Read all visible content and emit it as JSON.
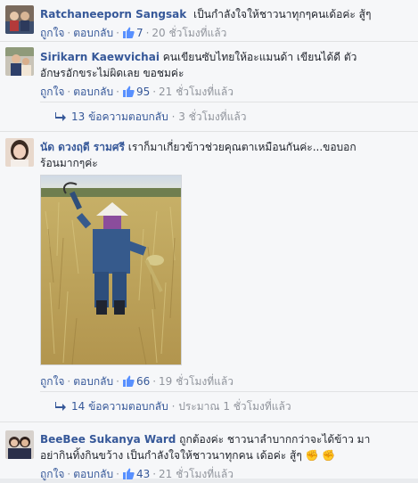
{
  "comments": [
    {
      "author": "Ratchaneeporn Sangsak",
      "text": "เป็นกำลังใจให้ชาวนาทุกๆคนเด้อค่ะ สู้ๆ",
      "like_label": "ถูกใจ",
      "reply_label": "ตอบกลับ",
      "likes": "7",
      "time": "20 ชั่วโมงที่แล้ว"
    },
    {
      "author": "Sirikarn Kaewvichai",
      "text_line1": "คนเขียนซับไทยให้อะแมนด้า เขียนได้ดี ตัว",
      "text_line2": "อักษรอักขระไม่ผิดเลย ขอชมค่ะ",
      "like_label": "ถูกใจ",
      "reply_label": "ตอบกลับ",
      "likes": "95",
      "time": "21 ชั่วโมงที่แล้ว",
      "replies_label": "13 ข้อความตอบกลับ",
      "replies_time": "3 ชั่วโมงที่แล้ว"
    },
    {
      "author": "นัด ดวงฤดี รามศรี",
      "text_line1": "เราก็มาเกี่ยวข้าวช่วยคุณตาเหมือนกันค่ะ...ขอบอก",
      "text_line2": "ร้อนมากๆค่ะ",
      "like_label": "ถูกใจ",
      "reply_label": "ตอบกลับ",
      "likes": "66",
      "time": "19 ชั่วโมงที่แล้ว",
      "replies_label": "14 ข้อความตอบกลับ",
      "replies_time": "ประมาณ 1 ชั่วโมงที่แล้ว"
    },
    {
      "author": "BeeBee Sukanya Ward",
      "text_line1": "ถูกต้องค่ะ ชาวนาลำบากกว่าจะได้ข้าว มา",
      "text_line2": "อย่ากินทิ้งกินขว้าง เป็นกำลังใจให้ชาวนาทุกคน เด้อค่ะ สู้ๆ",
      "like_label": "ถูกใจ",
      "reply_label": "ตอบกลับ",
      "likes": "43",
      "time": "21 ชั่วโมงที่แล้ว"
    }
  ],
  "colors": {
    "link": "#365899",
    "meta": "#90949c",
    "background": "#f6f7f9"
  }
}
